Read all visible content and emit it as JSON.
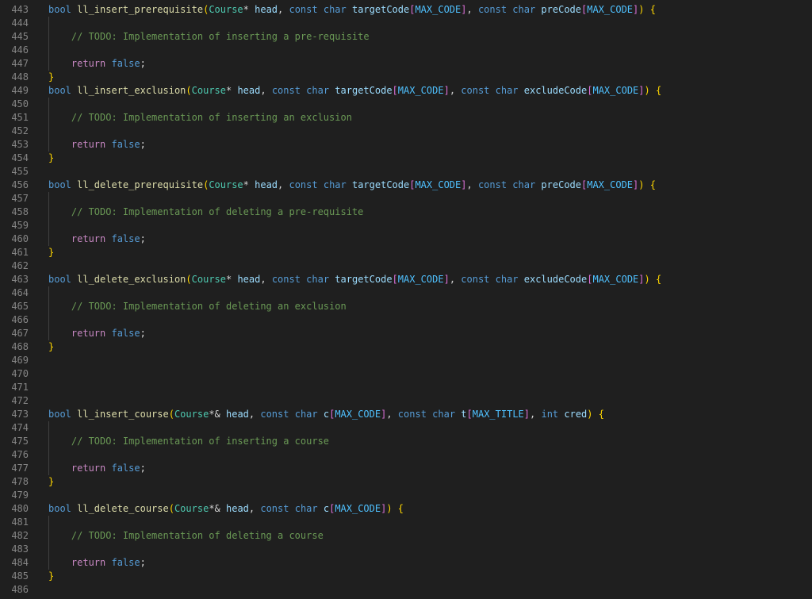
{
  "editor": {
    "lines": [
      {
        "n": "443",
        "t": [
          [
            "bool ",
            "#569cd6"
          ],
          [
            "ll_insert_prerequisite",
            "#dcdcaa"
          ],
          [
            "(",
            "#ffd700"
          ],
          [
            "Course",
            "#4ec9b0"
          ],
          [
            "* ",
            "#d4d4d4"
          ],
          [
            "head",
            "#9cdcfe"
          ],
          [
            ", ",
            "#d4d4d4"
          ],
          [
            "const ",
            "#569cd6"
          ],
          [
            "char ",
            "#569cd6"
          ],
          [
            "targetCode",
            "#9cdcfe"
          ],
          [
            "[",
            "#da70d6"
          ],
          [
            "MAX_CODE",
            "#4fc1ff"
          ],
          [
            "]",
            "#da70d6"
          ],
          [
            ", ",
            "#d4d4d4"
          ],
          [
            "const ",
            "#569cd6"
          ],
          [
            "char ",
            "#569cd6"
          ],
          [
            "preCode",
            "#9cdcfe"
          ],
          [
            "[",
            "#da70d6"
          ],
          [
            "MAX_CODE",
            "#4fc1ff"
          ],
          [
            "]",
            "#da70d6"
          ],
          [
            ") ",
            "#ffd700"
          ],
          [
            "{",
            "#ffd700"
          ]
        ]
      },
      {
        "n": "444",
        "t": []
      },
      {
        "n": "445",
        "t": [
          [
            "    ",
            "#d4d4d4"
          ],
          [
            "// TODO: Implementation of inserting a pre-requisite",
            "#6a9955"
          ]
        ]
      },
      {
        "n": "446",
        "t": []
      },
      {
        "n": "447",
        "t": [
          [
            "    ",
            "#d4d4d4"
          ],
          [
            "return ",
            "#c586c0"
          ],
          [
            "false",
            "#569cd6"
          ],
          [
            ";",
            "#d4d4d4"
          ]
        ]
      },
      {
        "n": "448",
        "t": [
          [
            "}",
            "#ffd700"
          ]
        ]
      },
      {
        "n": "449",
        "t": [
          [
            "bool ",
            "#569cd6"
          ],
          [
            "ll_insert_exclusion",
            "#dcdcaa"
          ],
          [
            "(",
            "#ffd700"
          ],
          [
            "Course",
            "#4ec9b0"
          ],
          [
            "* ",
            "#d4d4d4"
          ],
          [
            "head",
            "#9cdcfe"
          ],
          [
            ", ",
            "#d4d4d4"
          ],
          [
            "const ",
            "#569cd6"
          ],
          [
            "char ",
            "#569cd6"
          ],
          [
            "targetCode",
            "#9cdcfe"
          ],
          [
            "[",
            "#da70d6"
          ],
          [
            "MAX_CODE",
            "#4fc1ff"
          ],
          [
            "]",
            "#da70d6"
          ],
          [
            ", ",
            "#d4d4d4"
          ],
          [
            "const ",
            "#569cd6"
          ],
          [
            "char ",
            "#569cd6"
          ],
          [
            "excludeCode",
            "#9cdcfe"
          ],
          [
            "[",
            "#da70d6"
          ],
          [
            "MAX_CODE",
            "#4fc1ff"
          ],
          [
            "]",
            "#da70d6"
          ],
          [
            ") ",
            "#ffd700"
          ],
          [
            "{",
            "#ffd700"
          ]
        ]
      },
      {
        "n": "450",
        "t": []
      },
      {
        "n": "451",
        "t": [
          [
            "    ",
            "#d4d4d4"
          ],
          [
            "// TODO: Implementation of inserting an exclusion",
            "#6a9955"
          ]
        ]
      },
      {
        "n": "452",
        "t": []
      },
      {
        "n": "453",
        "t": [
          [
            "    ",
            "#d4d4d4"
          ],
          [
            "return ",
            "#c586c0"
          ],
          [
            "false",
            "#569cd6"
          ],
          [
            ";",
            "#d4d4d4"
          ]
        ]
      },
      {
        "n": "454",
        "t": [
          [
            "}",
            "#ffd700"
          ]
        ]
      },
      {
        "n": "455",
        "t": []
      },
      {
        "n": "456",
        "t": [
          [
            "bool ",
            "#569cd6"
          ],
          [
            "ll_delete_prerequisite",
            "#dcdcaa"
          ],
          [
            "(",
            "#ffd700"
          ],
          [
            "Course",
            "#4ec9b0"
          ],
          [
            "* ",
            "#d4d4d4"
          ],
          [
            "head",
            "#9cdcfe"
          ],
          [
            ", ",
            "#d4d4d4"
          ],
          [
            "const ",
            "#569cd6"
          ],
          [
            "char ",
            "#569cd6"
          ],
          [
            "targetCode",
            "#9cdcfe"
          ],
          [
            "[",
            "#da70d6"
          ],
          [
            "MAX_CODE",
            "#4fc1ff"
          ],
          [
            "]",
            "#da70d6"
          ],
          [
            ", ",
            "#d4d4d4"
          ],
          [
            "const ",
            "#569cd6"
          ],
          [
            "char ",
            "#569cd6"
          ],
          [
            "preCode",
            "#9cdcfe"
          ],
          [
            "[",
            "#da70d6"
          ],
          [
            "MAX_CODE",
            "#4fc1ff"
          ],
          [
            "]",
            "#da70d6"
          ],
          [
            ") ",
            "#ffd700"
          ],
          [
            "{",
            "#ffd700"
          ]
        ]
      },
      {
        "n": "457",
        "t": []
      },
      {
        "n": "458",
        "t": [
          [
            "    ",
            "#d4d4d4"
          ],
          [
            "// TODO: Implementation of deleting a pre-requisite",
            "#6a9955"
          ]
        ]
      },
      {
        "n": "459",
        "t": []
      },
      {
        "n": "460",
        "t": [
          [
            "    ",
            "#d4d4d4"
          ],
          [
            "return ",
            "#c586c0"
          ],
          [
            "false",
            "#569cd6"
          ],
          [
            ";",
            "#d4d4d4"
          ]
        ]
      },
      {
        "n": "461",
        "t": [
          [
            "}",
            "#ffd700"
          ]
        ]
      },
      {
        "n": "462",
        "t": []
      },
      {
        "n": "463",
        "t": [
          [
            "bool ",
            "#569cd6"
          ],
          [
            "ll_delete_exclusion",
            "#dcdcaa"
          ],
          [
            "(",
            "#ffd700"
          ],
          [
            "Course",
            "#4ec9b0"
          ],
          [
            "* ",
            "#d4d4d4"
          ],
          [
            "head",
            "#9cdcfe"
          ],
          [
            ", ",
            "#d4d4d4"
          ],
          [
            "const ",
            "#569cd6"
          ],
          [
            "char ",
            "#569cd6"
          ],
          [
            "targetCode",
            "#9cdcfe"
          ],
          [
            "[",
            "#da70d6"
          ],
          [
            "MAX_CODE",
            "#4fc1ff"
          ],
          [
            "]",
            "#da70d6"
          ],
          [
            ", ",
            "#d4d4d4"
          ],
          [
            "const ",
            "#569cd6"
          ],
          [
            "char ",
            "#569cd6"
          ],
          [
            "excludeCode",
            "#9cdcfe"
          ],
          [
            "[",
            "#da70d6"
          ],
          [
            "MAX_CODE",
            "#4fc1ff"
          ],
          [
            "]",
            "#da70d6"
          ],
          [
            ") ",
            "#ffd700"
          ],
          [
            "{",
            "#ffd700"
          ]
        ]
      },
      {
        "n": "464",
        "t": []
      },
      {
        "n": "465",
        "t": [
          [
            "    ",
            "#d4d4d4"
          ],
          [
            "// TODO: Implementation of deleting an exclusion",
            "#6a9955"
          ]
        ]
      },
      {
        "n": "466",
        "t": []
      },
      {
        "n": "467",
        "t": [
          [
            "    ",
            "#d4d4d4"
          ],
          [
            "return ",
            "#c586c0"
          ],
          [
            "false",
            "#569cd6"
          ],
          [
            ";",
            "#d4d4d4"
          ]
        ]
      },
      {
        "n": "468",
        "t": [
          [
            "}",
            "#ffd700"
          ]
        ]
      },
      {
        "n": "469",
        "t": []
      },
      {
        "n": "470",
        "t": []
      },
      {
        "n": "471",
        "t": []
      },
      {
        "n": "472",
        "t": []
      },
      {
        "n": "473",
        "t": [
          [
            "bool ",
            "#569cd6"
          ],
          [
            "ll_insert_course",
            "#dcdcaa"
          ],
          [
            "(",
            "#ffd700"
          ],
          [
            "Course",
            "#4ec9b0"
          ],
          [
            "*& ",
            "#d4d4d4"
          ],
          [
            "head",
            "#9cdcfe"
          ],
          [
            ", ",
            "#d4d4d4"
          ],
          [
            "const ",
            "#569cd6"
          ],
          [
            "char ",
            "#569cd6"
          ],
          [
            "c",
            "#9cdcfe"
          ],
          [
            "[",
            "#da70d6"
          ],
          [
            "MAX_CODE",
            "#4fc1ff"
          ],
          [
            "]",
            "#da70d6"
          ],
          [
            ", ",
            "#d4d4d4"
          ],
          [
            "const ",
            "#569cd6"
          ],
          [
            "char ",
            "#569cd6"
          ],
          [
            "t",
            "#9cdcfe"
          ],
          [
            "[",
            "#da70d6"
          ],
          [
            "MAX_TITLE",
            "#4fc1ff"
          ],
          [
            "]",
            "#da70d6"
          ],
          [
            ", ",
            "#d4d4d4"
          ],
          [
            "int ",
            "#569cd6"
          ],
          [
            "cred",
            "#9cdcfe"
          ],
          [
            ") ",
            "#ffd700"
          ],
          [
            "{",
            "#ffd700"
          ]
        ]
      },
      {
        "n": "474",
        "t": []
      },
      {
        "n": "475",
        "t": [
          [
            "    ",
            "#d4d4d4"
          ],
          [
            "// TODO: Implementation of inserting a course",
            "#6a9955"
          ]
        ]
      },
      {
        "n": "476",
        "t": []
      },
      {
        "n": "477",
        "t": [
          [
            "    ",
            "#d4d4d4"
          ],
          [
            "return ",
            "#c586c0"
          ],
          [
            "false",
            "#569cd6"
          ],
          [
            ";",
            "#d4d4d4"
          ]
        ]
      },
      {
        "n": "478",
        "t": [
          [
            "}",
            "#ffd700"
          ]
        ]
      },
      {
        "n": "479",
        "t": []
      },
      {
        "n": "480",
        "t": [
          [
            "bool ",
            "#569cd6"
          ],
          [
            "ll_delete_course",
            "#dcdcaa"
          ],
          [
            "(",
            "#ffd700"
          ],
          [
            "Course",
            "#4ec9b0"
          ],
          [
            "*& ",
            "#d4d4d4"
          ],
          [
            "head",
            "#9cdcfe"
          ],
          [
            ", ",
            "#d4d4d4"
          ],
          [
            "const ",
            "#569cd6"
          ],
          [
            "char ",
            "#569cd6"
          ],
          [
            "c",
            "#9cdcfe"
          ],
          [
            "[",
            "#da70d6"
          ],
          [
            "MAX_CODE",
            "#4fc1ff"
          ],
          [
            "]",
            "#da70d6"
          ],
          [
            ") ",
            "#ffd700"
          ],
          [
            "{",
            "#ffd700"
          ]
        ]
      },
      {
        "n": "481",
        "t": []
      },
      {
        "n": "482",
        "t": [
          [
            "    ",
            "#d4d4d4"
          ],
          [
            "// TODO: Implementation of deleting a course",
            "#6a9955"
          ]
        ]
      },
      {
        "n": "483",
        "t": []
      },
      {
        "n": "484",
        "t": [
          [
            "    ",
            "#d4d4d4"
          ],
          [
            "return ",
            "#c586c0"
          ],
          [
            "false",
            "#569cd6"
          ],
          [
            ";",
            "#d4d4d4"
          ]
        ]
      },
      {
        "n": "485",
        "t": [
          [
            "}",
            "#ffd700"
          ]
        ]
      },
      {
        "n": "486",
        "t": []
      }
    ]
  },
  "colors": {
    "background": "#1f1f1f",
    "line_number": "#858585",
    "keyword": "#569cd6",
    "control_keyword": "#c586c0",
    "function": "#dcdcaa",
    "type": "#4ec9b0",
    "parameter": "#9cdcfe",
    "constant": "#4fc1ff",
    "comment": "#6a9955",
    "bracket_1": "#ffd700",
    "bracket_2": "#da70d6"
  }
}
